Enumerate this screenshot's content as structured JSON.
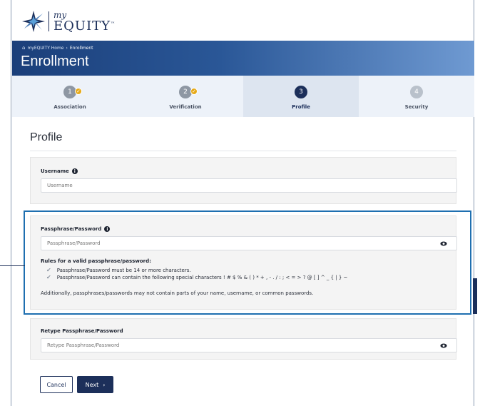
{
  "logo": {
    "my": "my",
    "name": "EQUITY",
    "tm": "™"
  },
  "breadcrumb": {
    "home": "myEQUITY Home",
    "separator": "›",
    "current": "Enrollment"
  },
  "banner": {
    "title": "Enrollment"
  },
  "steps": [
    {
      "number": "1",
      "label": "Association",
      "state": "done"
    },
    {
      "number": "2",
      "label": "Verification",
      "state": "done"
    },
    {
      "number": "3",
      "label": "Profile",
      "state": "current"
    },
    {
      "number": "4",
      "label": "Security",
      "state": "todo"
    }
  ],
  "page": {
    "heading": "Profile"
  },
  "username": {
    "label": "Username",
    "placeholder": "Username"
  },
  "password": {
    "label": "Passphrase/Password",
    "placeholder": "Passphrase/Password",
    "rules_title": "Rules for a valid passphrase/password:",
    "rules": [
      "Passphrase/Password must be 14 or more characters.",
      "Passphrase/Password can contain the following special characters ! # $ % & ( ) * + , - . / : ; < = > ? @ [ ] ^ _ { | } ~"
    ],
    "note": "Additionally, passphrases/passwords may not contain parts of your name, username, or common passwords."
  },
  "retype": {
    "label": "Retype Passphrase/Password",
    "placeholder": "Retype Passphrase/Password"
  },
  "buttons": {
    "cancel": "Cancel",
    "next": "Next",
    "next_arrow": "›"
  },
  "colors": {
    "navy": "#1c2f5a",
    "check_gold": "#e6a917",
    "highlight": "#1e6fb0"
  },
  "icons": [
    "home-icon",
    "check-icon",
    "info-icon",
    "eye-icon",
    "chevron-right-icon"
  ]
}
